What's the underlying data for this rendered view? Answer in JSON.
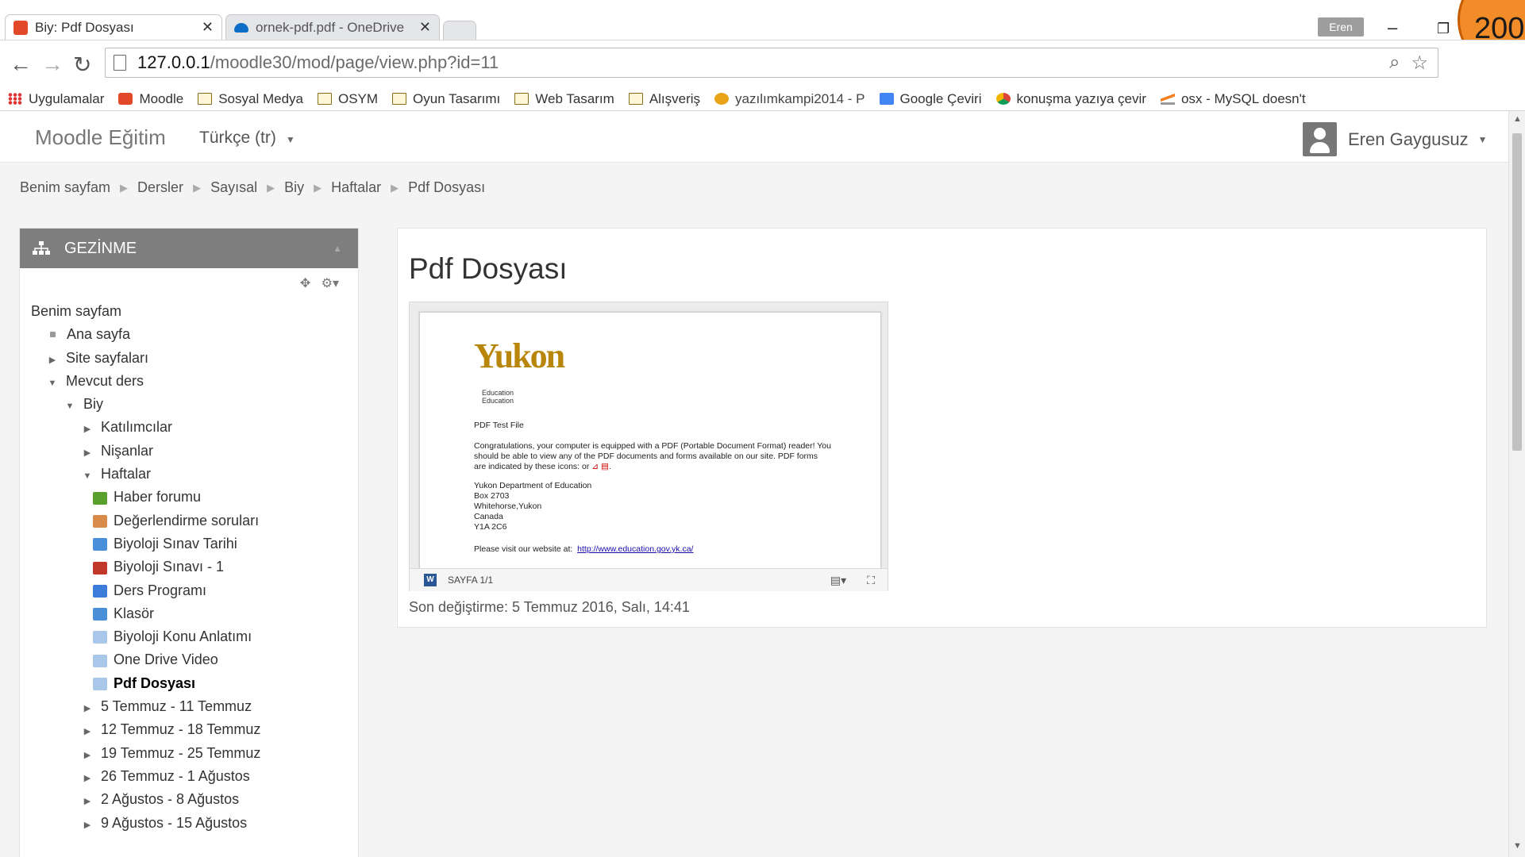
{
  "browser": {
    "tabs": [
      {
        "title": "Biy: Pdf Dosyası",
        "active": true,
        "favicon": "moodle-favicon-icon",
        "color": "#e2492a"
      },
      {
        "title": "ornek-pdf.pdf - OneDrive",
        "active": false,
        "favicon": "onedrive-icon",
        "color": "#0f6fc6"
      }
    ],
    "user_chip": "Eren",
    "corner_badge": "200",
    "address": {
      "host": "127.0.0.1",
      "path": "/moodle30/mod/page/view.php?id=11"
    },
    "bookmarks": [
      {
        "label": "Uygulamalar",
        "icon": "apps-grid-icon"
      },
      {
        "label": "Moodle",
        "icon": "moodle-bookmark-icon"
      },
      {
        "label": "Sosyal Medya",
        "icon": "folder-icon"
      },
      {
        "label": "OSYM",
        "icon": "folder-icon"
      },
      {
        "label": "Oyun Tasarımı",
        "icon": "folder-icon"
      },
      {
        "label": "Web Tasarım",
        "icon": "folder-icon"
      },
      {
        "label": "Alışveriş",
        "icon": "folder-icon"
      },
      {
        "label": "yazılımkampi2014 - P",
        "icon": "tiger-icon"
      },
      {
        "label": "Google Çeviri",
        "icon": "google-translate-icon"
      },
      {
        "label": "konuşma yazıya çevir",
        "icon": "chrome-icon"
      },
      {
        "label": "osx - MySQL doesn't",
        "icon": "stackoverflow-icon"
      }
    ]
  },
  "moodle": {
    "brand": "Moodle Eğitim",
    "language": "Türkçe (tr)",
    "user": "Eren Gaygusuz",
    "breadcrumb": [
      "Benim sayfam",
      "Dersler",
      "Sayısal",
      "Biy",
      "Haftalar",
      "Pdf Dosyası"
    ],
    "nav_block": {
      "title": "GEZİNME",
      "items": [
        {
          "label": "Benim sayfam",
          "level": 0,
          "toggle": "none"
        },
        {
          "label": "Ana sayfa",
          "level": 1,
          "toggle": "dot"
        },
        {
          "label": "Site sayfaları",
          "level": 1,
          "toggle": "collapsed"
        },
        {
          "label": "Mevcut ders",
          "level": 1,
          "toggle": "expanded"
        },
        {
          "label": "Biy",
          "level": 2,
          "toggle": "expanded"
        },
        {
          "label": "Katılımcılar",
          "level": 3,
          "toggle": "collapsed"
        },
        {
          "label": "Nişanlar",
          "level": 3,
          "toggle": "collapsed"
        },
        {
          "label": "Haftalar",
          "level": 3,
          "toggle": "expanded"
        },
        {
          "label": "Haber forumu",
          "level": 4,
          "toggle": "forum-icon"
        },
        {
          "label": "Değerlendirme soruları",
          "level": 4,
          "toggle": "feedback-icon"
        },
        {
          "label": "Biyoloji Sınav Tarihi",
          "level": 4,
          "toggle": "question-icon"
        },
        {
          "label": "Biyoloji Sınavı - 1",
          "level": 4,
          "toggle": "quiz-icon"
        },
        {
          "label": "Ders Programı",
          "level": 4,
          "toggle": "url-icon"
        },
        {
          "label": "Klasör",
          "level": 4,
          "toggle": "folder-icon"
        },
        {
          "label": "Biyoloji Konu Anlatımı",
          "level": 4,
          "toggle": "page-icon"
        },
        {
          "label": "One Drive Video",
          "level": 4,
          "toggle": "page-icon"
        },
        {
          "label": "Pdf Dosyası",
          "level": 4,
          "toggle": "page-icon",
          "current": true
        },
        {
          "label": "5 Temmuz - 11 Temmuz",
          "level": 3,
          "toggle": "collapsed"
        },
        {
          "label": "12 Temmuz - 18 Temmuz",
          "level": 3,
          "toggle": "collapsed"
        },
        {
          "label": "19 Temmuz - 25 Temmuz",
          "level": 3,
          "toggle": "collapsed"
        },
        {
          "label": "26 Temmuz - 1 Ağustos",
          "level": 3,
          "toggle": "collapsed"
        },
        {
          "label": "2 Ağustos - 8 Ağustos",
          "level": 3,
          "toggle": "collapsed"
        },
        {
          "label": "9 Ağustos - 15 Ağustos",
          "level": 3,
          "toggle": "collapsed"
        }
      ]
    },
    "page": {
      "title": "Pdf Dosyası",
      "pdf": {
        "logo": "Yukon",
        "logo_sub": "Education",
        "heading": "PDF Test File",
        "body": "Congratulations, your computer is equipped with a PDF (Portable Document Format) reader! You should be able to view any of the PDF documents and forms available on our site. PDF forms are indicated by these icons: or",
        "address": [
          "Yukon Department of Education",
          "Box 2703",
          "Whitehorse,Yukon",
          "Canada",
          "Y1A 2C6"
        ],
        "visit_text": "Please visit our website at:",
        "visit_link": "http://www.education.gov.yk.ca/"
      },
      "viewer_page": "SAYFA 1/1",
      "modified": "Son değiştirme: 5 Temmuz 2016, Salı, 14:41"
    }
  }
}
